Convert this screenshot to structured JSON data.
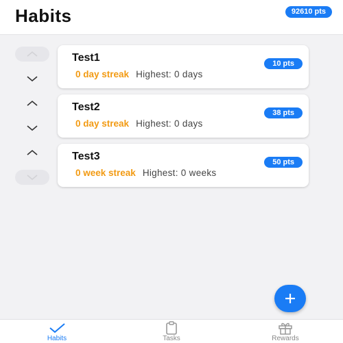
{
  "header": {
    "title": "Habits",
    "total_points": "92610 pts"
  },
  "habits": [
    {
      "name": "Test1",
      "points": "10 pts",
      "streak": "0 day streak",
      "highest": "Highest: 0 days"
    },
    {
      "name": "Test2",
      "points": "38 pts",
      "streak": "0 day streak",
      "highest": "Highest: 0 days"
    },
    {
      "name": "Test3",
      "points": "50 pts",
      "streak": "0 week streak",
      "highest": "Highest: 0 weeks"
    }
  ],
  "icons": {
    "up": "chevron-up-icon",
    "down": "chevron-down-icon",
    "add": "plus-icon",
    "habits": "checkmark-icon",
    "tasks": "clipboard-icon",
    "rewards": "gift-icon"
  },
  "tabs": [
    {
      "label": "Habits",
      "active": true
    },
    {
      "label": "Tasks",
      "active": false
    },
    {
      "label": "Rewards",
      "active": false
    }
  ],
  "colors": {
    "accent": "#1a7cf5",
    "streak": "#f29a12"
  }
}
